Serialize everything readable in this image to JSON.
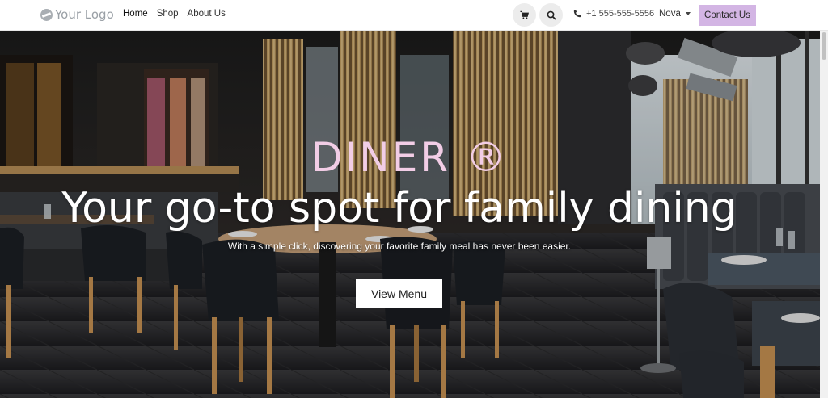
{
  "header": {
    "logo_text": "Your Logo",
    "nav": [
      {
        "label": "Home",
        "active": true
      },
      {
        "label": "Shop",
        "active": false
      },
      {
        "label": "About Us",
        "active": false
      }
    ],
    "cart_icon": "cart-icon",
    "search_icon": "search-icon",
    "phone_icon": "phone-icon",
    "phone": "+1 555-555-5556",
    "user": "Nova",
    "contact_label": "Contact Us"
  },
  "hero": {
    "brand": "DINER ®",
    "title": "Your go-to spot for family dining",
    "subtitle": "With a simple click, discovering your favorite family meal has never been easier.",
    "cta_label": "View Menu"
  },
  "colors": {
    "accent": "#d3b5e4",
    "brand_text": "#f2cde6"
  }
}
